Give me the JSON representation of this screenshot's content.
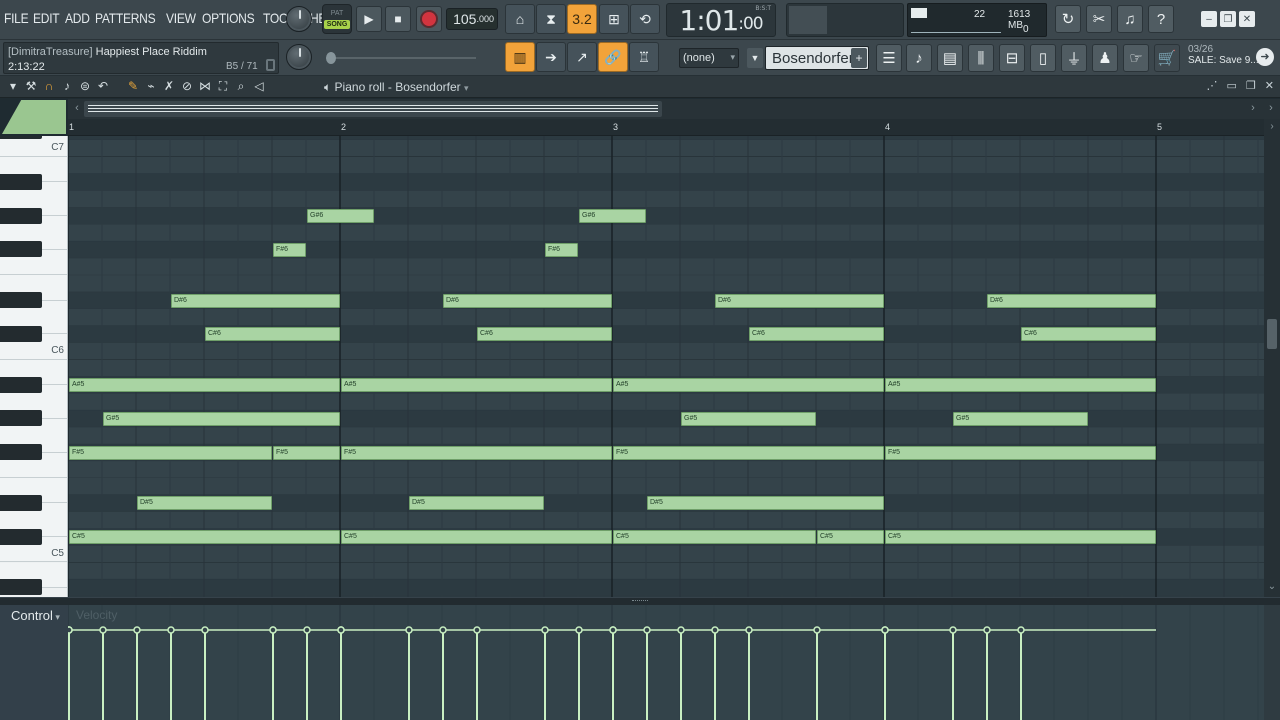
{
  "menu": [
    "FILE",
    "EDIT",
    "ADD",
    "PATTERNS",
    "VIEW",
    "OPTIONS",
    "TOOLS",
    "HELP"
  ],
  "transport": {
    "pat_label": "PAT",
    "song_label": "SONG",
    "tempo": "105",
    "tempo_decimal": ".000",
    "time": "1:01",
    "time_sub": ":00",
    "bst_label": "B:S:T",
    "snap_value": "3.2"
  },
  "cpu": {
    "cpu_value": "22",
    "memory": "1613 MB",
    "polyphony": "0"
  },
  "hint_bar": {
    "author": "[DimitraTreasure]",
    "project": "Happiest Place Riddim",
    "time": "2:13:22",
    "position": "B5 / 71"
  },
  "toolbar2": {
    "snap_select": "(none)",
    "channel": "Bosendorfer",
    "news_date": "03/26",
    "news_text": "SALE: Save 9..."
  },
  "piano_roll": {
    "title": "Piano roll - Bosendorfer",
    "control_label": "Control",
    "velocity_label": "Velocity"
  },
  "ruler_bars": [
    "1",
    "2",
    "3",
    "4",
    "5"
  ],
  "key_labels": [
    "C7",
    "C6",
    "C5"
  ],
  "colors": {
    "note_fill": "#a9d4a3",
    "accent_orange": "#f2a33a",
    "grid_bg": "#34434a",
    "velocity_line": "#c9f0c2"
  },
  "notes": [
    {
      "pitch": "G#6",
      "start": 7.0,
      "length": 2.0
    },
    {
      "pitch": "G#6",
      "start": 15.0,
      "length": 2.0
    },
    {
      "pitch": "F#6",
      "start": 6.0,
      "length": 1.0
    },
    {
      "pitch": "F#6",
      "start": 14.0,
      "length": 1.0
    },
    {
      "pitch": "D#6",
      "start": 3.0,
      "length": 5.0
    },
    {
      "pitch": "D#6",
      "start": 11.0,
      "length": 5.0
    },
    {
      "pitch": "D#6",
      "start": 19.0,
      "length": 5.0
    },
    {
      "pitch": "D#6",
      "start": 27.0,
      "length": 5.0
    },
    {
      "pitch": "C#6",
      "start": 4.0,
      "length": 4.0
    },
    {
      "pitch": "C#6",
      "start": 12.0,
      "length": 4.0
    },
    {
      "pitch": "C#6",
      "start": 20.0,
      "length": 4.0
    },
    {
      "pitch": "C#6",
      "start": 28.0,
      "length": 4.0
    },
    {
      "pitch": "A#5",
      "start": 0.0,
      "length": 8.0
    },
    {
      "pitch": "A#5",
      "start": 8.0,
      "length": 8.0
    },
    {
      "pitch": "A#5",
      "start": 16.0,
      "length": 8.0
    },
    {
      "pitch": "A#5",
      "start": 24.0,
      "length": 8.0
    },
    {
      "pitch": "G#5",
      "start": 1.0,
      "length": 7.0
    },
    {
      "pitch": "G#5",
      "start": 18.0,
      "length": 4.0
    },
    {
      "pitch": "G#5",
      "start": 26.0,
      "length": 4.0
    },
    {
      "pitch": "F#5",
      "start": 0.0,
      "length": 6.0
    },
    {
      "pitch": "F#5",
      "start": 6.0,
      "length": 2.0
    },
    {
      "pitch": "F#5",
      "start": 8.0,
      "length": 8.0
    },
    {
      "pitch": "F#5",
      "start": 16.0,
      "length": 8.0
    },
    {
      "pitch": "F#5",
      "start": 24.0,
      "length": 8.0
    },
    {
      "pitch": "D#5",
      "start": 2.0,
      "length": 4.0
    },
    {
      "pitch": "D#5",
      "start": 10.0,
      "length": 4.0
    },
    {
      "pitch": "D#5",
      "start": 17.0,
      "length": 7.0
    },
    {
      "pitch": "C#5",
      "start": 0.0,
      "length": 8.0
    },
    {
      "pitch": "C#5",
      "start": 8.0,
      "length": 8.0
    },
    {
      "pitch": "C#5",
      "start": 16.0,
      "length": 6.0
    },
    {
      "pitch": "C#5",
      "start": 22.0,
      "length": 2.0
    },
    {
      "pitch": "C#5",
      "start": 24.0,
      "length": 8.0
    }
  ]
}
